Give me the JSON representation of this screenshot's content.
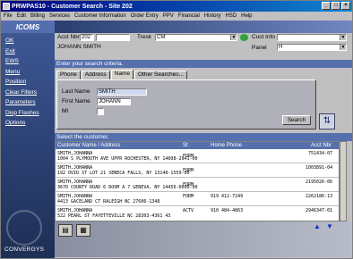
{
  "title": "PRWPAS10 - Customer Search - Site 202",
  "menu": [
    "File",
    "Edit",
    "Billing",
    "Services",
    "Customer Information",
    "Order Entry",
    "PPV",
    "Financial",
    "History",
    "HSD",
    "Help"
  ],
  "brand": "ICOMS",
  "sidebar": [
    "OK",
    "Exit",
    "EWS",
    "Menu",
    "Position",
    "Clear Filters",
    "Parameters",
    "Disp Flashes",
    "Options"
  ],
  "sidebar_logo": "CONVERGYS",
  "header": {
    "acct_nbr_label": "Acct Nbr",
    "acct_nbr_value": "202",
    "tresk_label": "Tresk",
    "tresk_value": "CM",
    "cust_info_label": "Cust Info",
    "panel_label": "Panel",
    "panel_value": "H",
    "customer_name": "JOHANN SMITH"
  },
  "instruction": "Enter your search criteria.",
  "tabs": [
    "Phone",
    "Address",
    "Name",
    "Other Searches..."
  ],
  "active_tab": "Name",
  "form": {
    "last_name_label": "Last Name",
    "last_name_value": "SMITH",
    "first_name_label": "First Name",
    "first_name_value": "JOHANN",
    "mi_label": "MI",
    "search_button": "Search"
  },
  "select_instruction": "Select the customer.",
  "grid": {
    "headers": {
      "name": "Customer Name / Address",
      "st": "St",
      "phone": "Home Phone",
      "acct": "Acct Nbr"
    },
    "rows": [
      {
        "name": "SMITH,JOHANNA",
        "addr": "1004 S PLYMOUTH AVE UPPR ROCHESTER, NY 14608-2941-00",
        "st": "FORM",
        "phone": "",
        "acct": "751434-07"
      },
      {
        "name": "SMITH,JOHANNA",
        "addr": "192 OVID ST LOT 21 SENECA FALLS, NY 13148-1559-00",
        "st": "FORM",
        "phone": "",
        "acct": "1003891-04"
      },
      {
        "name": "SMITH,JOHANNA",
        "addr": "3670 COUNTY ROAD 6 ROOM A 7 GENEVA, NY 14456-0000-00",
        "st": "FORM",
        "phone": "",
        "acct": "2195026-06"
      },
      {
        "name": "SMITH,JOHANNA",
        "addr": "4413 GACELAND CT RALEIGH  NC 27606-1348",
        "st": "FORM",
        "phone": "919 412-7249",
        "acct": "2262186-13"
      },
      {
        "name": "SMITH,JOHANNA",
        "addr": "522 PEARL ST FAYETTEVILLE NC 28303-4361 43",
        "st": "ACTV",
        "phone": "910 484-4863",
        "acct": "2946347-01"
      }
    ]
  }
}
